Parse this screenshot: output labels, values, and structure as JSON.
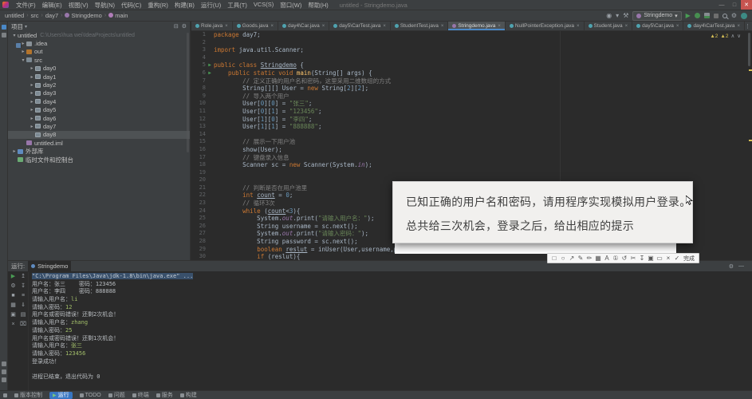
{
  "window": {
    "title": "untitled - Stringdemo.java",
    "menus": [
      "文件(F)",
      "编辑(E)",
      "视图(V)",
      "导航(N)",
      "代码(C)",
      "重构(R)",
      "构建(B)",
      "运行(U)",
      "工具(T)",
      "VCS(S)",
      "窗口(W)",
      "帮助(H)"
    ],
    "controls": {
      "minimize": "—",
      "maximize": "□",
      "close": "✕"
    }
  },
  "breadcrumb": [
    "untitled",
    "src",
    "day7",
    "Stringdemo",
    "main"
  ],
  "toolbar": {
    "run_config": "Stringdemo",
    "icons": {
      "user": "◉",
      "hammer": "⚒",
      "gear": "⚙",
      "dropdown": "▾",
      "run": "▶",
      "overflow": "⋮"
    }
  },
  "project_panel": {
    "title": "项目",
    "header_icons": [
      "⊟",
      "⚙"
    ],
    "tree": [
      {
        "label": "untitled",
        "path": "C:\\Users\\hua wei\\IdeaProjects\\untitled",
        "depth": 0,
        "chev": "▾",
        "icon": "project"
      },
      {
        "label": ".idea",
        "depth": 1,
        "chev": "▸",
        "icon": "folder"
      },
      {
        "label": "out",
        "depth": 1,
        "chev": "▸",
        "icon": "folder-out"
      },
      {
        "label": "src",
        "depth": 1,
        "chev": "▾",
        "icon": "folder-src"
      },
      {
        "label": "day0",
        "depth": 2,
        "chev": "▸",
        "icon": "package"
      },
      {
        "label": "day1",
        "depth": 2,
        "chev": "▸",
        "icon": "package"
      },
      {
        "label": "day2",
        "depth": 2,
        "chev": "▸",
        "icon": "package"
      },
      {
        "label": "day3",
        "depth": 2,
        "chev": "▸",
        "icon": "package"
      },
      {
        "label": "day4",
        "depth": 2,
        "chev": "▸",
        "icon": "package"
      },
      {
        "label": "day5",
        "depth": 2,
        "chev": "▸",
        "icon": "package"
      },
      {
        "label": "day6",
        "depth": 2,
        "chev": "▸",
        "icon": "package"
      },
      {
        "label": "day7",
        "depth": 2,
        "chev": "▸",
        "icon": "package"
      },
      {
        "label": "day8",
        "depth": 2,
        "chev": "",
        "icon": "package",
        "selected": true
      },
      {
        "label": "untitled.iml",
        "depth": 1,
        "chev": "",
        "icon": "file-iml"
      },
      {
        "label": "外部库",
        "depth": 0,
        "chev": "▸",
        "icon": "libraries"
      },
      {
        "label": "临时文件和控制台",
        "depth": 0,
        "chev": "",
        "icon": "scratches"
      }
    ]
  },
  "editor": {
    "tabs": [
      {
        "label": "Role.java"
      },
      {
        "label": "Goods.java"
      },
      {
        "label": "day4\\Car.java"
      },
      {
        "label": "day5\\CarTest.java"
      },
      {
        "label": "StudentTest.java"
      },
      {
        "label": "Stringdemo.java",
        "active": true
      },
      {
        "label": "NullPointerException.java"
      },
      {
        "label": "Student.java"
      },
      {
        "label": "day5\\Car.java"
      },
      {
        "label": "day4\\CarTest.java"
      }
    ],
    "inspections": {
      "warn1": "▲2",
      "warn2": "▲2",
      "up": "∧",
      "down": "∨"
    },
    "lines": [
      {
        "n": 1,
        "segs": [
          [
            "package",
            "k"
          ],
          [
            " day7;",
            "p"
          ]
        ]
      },
      {
        "n": 2,
        "segs": []
      },
      {
        "n": 3,
        "segs": [
          [
            "import",
            "k"
          ],
          [
            " java.util.Scanner;",
            "p"
          ]
        ]
      },
      {
        "n": 4,
        "segs": []
      },
      {
        "n": 5,
        "run": true,
        "segs": [
          [
            "public class ",
            "k"
          ],
          [
            "Stringdemo",
            "u"
          ],
          [
            " {",
            "p"
          ]
        ]
      },
      {
        "n": 6,
        "run": true,
        "segs": [
          [
            "    public static void ",
            "k"
          ],
          [
            "main",
            "f"
          ],
          [
            "(String[] args) {",
            "p"
          ]
        ]
      },
      {
        "n": 7,
        "segs": [
          [
            "        // 定义正确的用户名和密码，这里采用二维数组的方式",
            "c"
          ]
        ]
      },
      {
        "n": 8,
        "segs": [
          [
            "        String[][] User = ",
            "p"
          ],
          [
            "new",
            "k"
          ],
          [
            " String[",
            "p"
          ],
          [
            "2",
            "n"
          ],
          [
            "][",
            "p"
          ],
          [
            "2",
            "n"
          ],
          [
            "];",
            "p"
          ]
        ]
      },
      {
        "n": 9,
        "segs": [
          [
            "        // 导入两个用户",
            "c"
          ]
        ]
      },
      {
        "n": 10,
        "segs": [
          [
            "        User[",
            "p"
          ],
          [
            "0",
            "n"
          ],
          [
            "][",
            "p"
          ],
          [
            "0",
            "n"
          ],
          [
            "] = ",
            "p"
          ],
          [
            "\"张三\"",
            "s"
          ],
          [
            ";",
            "p"
          ]
        ]
      },
      {
        "n": 11,
        "segs": [
          [
            "        User[",
            "p"
          ],
          [
            "0",
            "n"
          ],
          [
            "][",
            "p"
          ],
          [
            "1",
            "n"
          ],
          [
            "] = ",
            "p"
          ],
          [
            "\"123456\"",
            "s"
          ],
          [
            ";",
            "p"
          ]
        ]
      },
      {
        "n": 12,
        "segs": [
          [
            "        User[",
            "p"
          ],
          [
            "1",
            "n"
          ],
          [
            "][",
            "p"
          ],
          [
            "0",
            "n"
          ],
          [
            "] = ",
            "p"
          ],
          [
            "\"李四\"",
            "s"
          ],
          [
            ";",
            "p"
          ]
        ]
      },
      {
        "n": 13,
        "segs": [
          [
            "        User[",
            "p"
          ],
          [
            "1",
            "n"
          ],
          [
            "][",
            "p"
          ],
          [
            "1",
            "n"
          ],
          [
            "] = ",
            "p"
          ],
          [
            "\"888888\"",
            "s"
          ],
          [
            ";",
            "p"
          ]
        ]
      },
      {
        "n": 14,
        "segs": []
      },
      {
        "n": 15,
        "segs": [
          [
            "        // 展示一下用户池",
            "c"
          ]
        ]
      },
      {
        "n": 16,
        "segs": [
          [
            "        show(User);",
            "p"
          ]
        ]
      },
      {
        "n": 17,
        "segs": [
          [
            "        // 键盘录入信息",
            "c"
          ]
        ]
      },
      {
        "n": 18,
        "segs": [
          [
            "        Scanner sc = ",
            "p"
          ],
          [
            "new",
            "k"
          ],
          [
            " Scanner(System.",
            "p"
          ],
          [
            "in",
            "d"
          ],
          [
            ");",
            "p"
          ]
        ]
      },
      {
        "n": 19,
        "segs": []
      },
      {
        "n": 20,
        "segs": []
      },
      {
        "n": 21,
        "segs": [
          [
            "        // 判断是否在用户池里",
            "c"
          ]
        ]
      },
      {
        "n": 22,
        "segs": [
          [
            "        ",
            "p"
          ],
          [
            "int",
            "k"
          ],
          [
            " ",
            "p"
          ],
          [
            "count",
            "u"
          ],
          [
            " = ",
            "p"
          ],
          [
            "0",
            "n"
          ],
          [
            ";",
            "p"
          ]
        ]
      },
      {
        "n": 23,
        "segs": [
          [
            "        // 循环3次",
            "c"
          ]
        ]
      },
      {
        "n": 24,
        "segs": [
          [
            "        ",
            "p"
          ],
          [
            "while",
            "k"
          ],
          [
            " (",
            "p"
          ],
          [
            "count",
            "u"
          ],
          [
            "<",
            "p"
          ],
          [
            "3",
            "n"
          ],
          [
            "){",
            "p"
          ]
        ]
      },
      {
        "n": 25,
        "segs": [
          [
            "            System.",
            "p"
          ],
          [
            "out",
            "d"
          ],
          [
            ".print(",
            "p"
          ],
          [
            "\"请输入用户名：\"",
            "s"
          ],
          [
            ");",
            "p"
          ]
        ]
      },
      {
        "n": 26,
        "segs": [
          [
            "            String username = sc.next();",
            "p"
          ]
        ]
      },
      {
        "n": 27,
        "segs": [
          [
            "            System.",
            "p"
          ],
          [
            "out",
            "d"
          ],
          [
            ".print(",
            "p"
          ],
          [
            "\"请输入密码：\"",
            "s"
          ],
          [
            ");",
            "p"
          ]
        ]
      },
      {
        "n": 28,
        "segs": [
          [
            "            String password = sc.next();",
            "p"
          ]
        ]
      },
      {
        "n": 29,
        "segs": [
          [
            "            ",
            "p"
          ],
          [
            "boolean",
            "k"
          ],
          [
            " ",
            "p"
          ],
          [
            "reslut",
            "u"
          ],
          [
            " = inUser(User,username,password);",
            "p"
          ]
        ]
      },
      {
        "n": 30,
        "segs": [
          [
            "            ",
            "p"
          ],
          [
            "if",
            "k"
          ],
          [
            " (reslut){",
            "p"
          ]
        ]
      }
    ]
  },
  "overlay": {
    "text_line1": "已知正确的用户名和密码，请用程序实现模拟用户登录。",
    "text_line2": "总共给三次机会，登录之后，给出相应的提示",
    "toolbar": [
      {
        "name": "rect-tool-icon",
        "glyph": "□"
      },
      {
        "name": "ellipse-tool-icon",
        "glyph": "○"
      },
      {
        "name": "arrow-tool-icon",
        "glyph": "↗"
      },
      {
        "name": "pen-tool-icon",
        "glyph": "✎"
      },
      {
        "name": "marker-tool-icon",
        "glyph": "✏"
      },
      {
        "name": "mosaic-tool-icon",
        "glyph": "▦"
      },
      {
        "name": "text-tool-icon",
        "glyph": "A"
      },
      {
        "name": "step-number-tool-icon",
        "glyph": "①"
      },
      {
        "name": "undo-icon",
        "glyph": "↺"
      },
      {
        "name": "region-tool-icon",
        "glyph": "✂"
      },
      {
        "name": "download-icon",
        "glyph": "↧"
      },
      {
        "name": "copy-icon",
        "glyph": "▣"
      },
      {
        "name": "pin-icon",
        "glyph": "▭"
      },
      {
        "name": "cancel-icon",
        "glyph": "×"
      },
      {
        "name": "confirm-icon",
        "glyph": "✓"
      }
    ],
    "done_label": "完成"
  },
  "run_panel": {
    "title": "运行:",
    "tab": "Stringdemo",
    "toolbar_col1": [
      {
        "name": "rerun-button",
        "glyph": "▶",
        "green": true
      },
      {
        "name": "run-settings-icon",
        "glyph": "⚙"
      },
      {
        "name": "stop-button",
        "glyph": "■"
      },
      {
        "name": "restore-layout-icon",
        "glyph": "▦"
      },
      {
        "name": "pin-tab-icon",
        "glyph": "▣"
      },
      {
        "name": "close-icon",
        "glyph": "×"
      }
    ],
    "toolbar_col2": [
      {
        "name": "up-stack-trace-icon",
        "glyph": "↥"
      },
      {
        "name": "down-stack-trace-icon",
        "glyph": "↧"
      },
      {
        "name": "soft-wrap-icon",
        "glyph": "≡"
      },
      {
        "name": "scroll-to-end-icon",
        "glyph": "⇓"
      },
      {
        "name": "print-icon",
        "glyph": "▤"
      },
      {
        "name": "clear-all-icon",
        "glyph": "⌧"
      }
    ],
    "console": [
      {
        "segs": [
          [
            "\"C:\\Program Files\\Java\\jdk-1.8\\bin\\java.exe\" ...",
            "out selbg"
          ]
        ]
      },
      {
        "segs": [
          [
            "用户名：张三    密码：123456",
            "out"
          ]
        ]
      },
      {
        "segs": [
          [
            "用户名：李四    密码：888888",
            "out"
          ]
        ]
      },
      {
        "segs": [
          [
            "请输入用户名：",
            "out"
          ],
          [
            "li",
            "in"
          ]
        ]
      },
      {
        "segs": [
          [
            "请输入密码：",
            "out"
          ],
          [
            "12",
            "in"
          ]
        ]
      },
      {
        "segs": [
          [
            "用户名或密码错误！还剩2次机会！",
            "out"
          ]
        ]
      },
      {
        "segs": [
          [
            "请输入用户名：",
            "out"
          ],
          [
            "zhang",
            "in"
          ]
        ]
      },
      {
        "segs": [
          [
            "请输入密码：",
            "out"
          ],
          [
            "25",
            "in"
          ]
        ]
      },
      {
        "segs": [
          [
            "用户名或密码错误！还剩1次机会！",
            "out"
          ]
        ]
      },
      {
        "segs": [
          [
            "请输入用户名：",
            "out"
          ],
          [
            "张三",
            "in"
          ]
        ]
      },
      {
        "segs": [
          [
            "请输入密码：",
            "out"
          ],
          [
            "123456",
            "in"
          ]
        ]
      },
      {
        "segs": [
          [
            "登录成功！",
            "out"
          ]
        ]
      },
      {
        "segs": []
      },
      {
        "segs": [
          [
            "进程已结束，退出代码为 0",
            "out"
          ]
        ]
      }
    ]
  },
  "statusbar": {
    "items": [
      {
        "label": "版本控制",
        "icon": "branch"
      },
      {
        "label": "运行",
        "icon": "run",
        "active": true
      },
      {
        "label": "TODO",
        "icon": "list"
      },
      {
        "label": "问题",
        "icon": "problem"
      },
      {
        "label": "终端",
        "icon": "terminal"
      },
      {
        "label": "服务",
        "icon": "services"
      },
      {
        "label": "构建",
        "icon": "build"
      }
    ]
  }
}
